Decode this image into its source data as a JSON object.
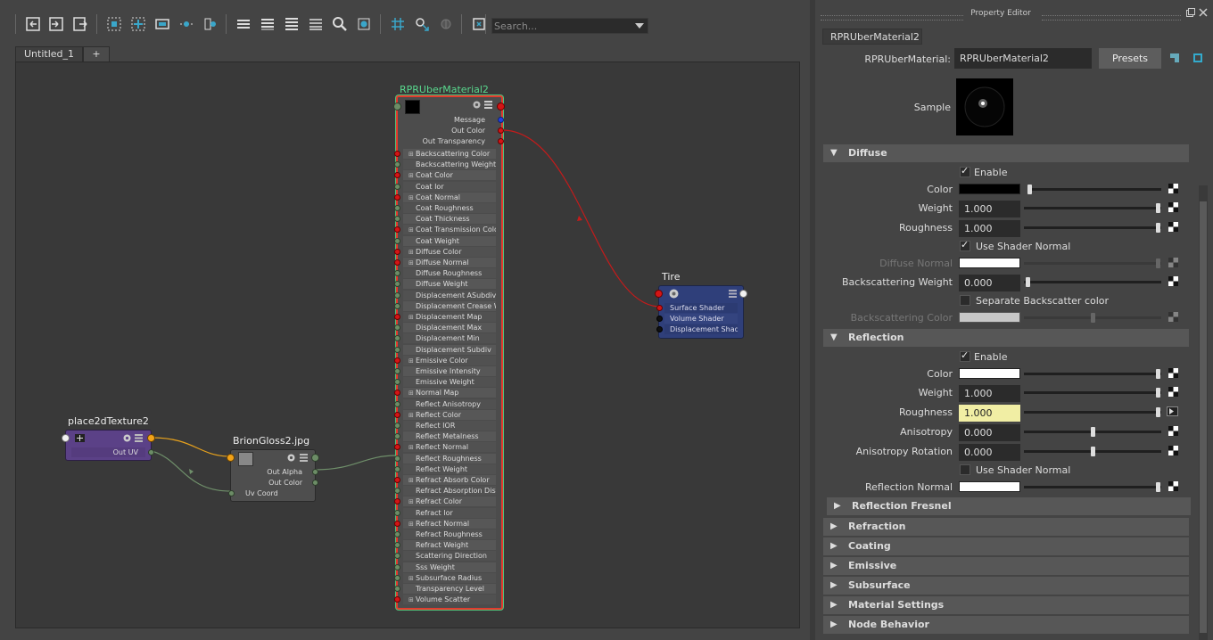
{
  "toolbar": {
    "icons": [
      "input-graph-icon",
      "output-graph-icon",
      "input-output-graph-icon",
      "frame-all-icon",
      "frame-selected-icon",
      "clear-graph-icon",
      "remove-selected-icon",
      "add-selected-icon",
      "simple-mode-icon",
      "connected-mode-icon",
      "full-mode-icon",
      "custom-mode-icon",
      "search-node-icon",
      "show-swatches-icon",
      "grid-toggle-icon",
      "snap-to-grid-icon",
      "pin-icon",
      "graph-materials-icon"
    ],
    "search_placeholder": "Search..."
  },
  "tabs": {
    "active": "Untitled_1",
    "add": "+"
  },
  "nodes": {
    "uber": {
      "title": "RPRUberMaterial2",
      "message": "Message",
      "out_color": "Out Color",
      "out_transparency": "Out Transparency",
      "attributes": [
        {
          "label": "Backscattering Color",
          "port": "red",
          "expand": true
        },
        {
          "label": "Backscattering Weight",
          "port": "green",
          "expand": false
        },
        {
          "label": "Coat Color",
          "port": "red",
          "expand": true
        },
        {
          "label": "Coat Ior",
          "port": "green",
          "expand": false
        },
        {
          "label": "Coat Normal",
          "port": "red",
          "expand": true
        },
        {
          "label": "Coat Roughness",
          "port": "green",
          "expand": false
        },
        {
          "label": "Coat Thickness",
          "port": "green",
          "expand": false
        },
        {
          "label": "Coat Transmission Color",
          "port": "red",
          "expand": true
        },
        {
          "label": "Coat Weight",
          "port": "green",
          "expand": false
        },
        {
          "label": "Diffuse Color",
          "port": "red",
          "expand": true
        },
        {
          "label": "Diffuse Normal",
          "port": "red",
          "expand": true
        },
        {
          "label": "Diffuse Roughness",
          "port": "green",
          "expand": false
        },
        {
          "label": "Diffuse Weight",
          "port": "green",
          "expand": false
        },
        {
          "label": "Displacement ASubdiv Factor",
          "port": "green",
          "expand": false
        },
        {
          "label": "Displacement Crease Weight",
          "port": "green",
          "expand": false
        },
        {
          "label": "Displacement Map",
          "port": "red",
          "expand": true
        },
        {
          "label": "Displacement Max",
          "port": "green",
          "expand": false
        },
        {
          "label": "Displacement Min",
          "port": "green",
          "expand": false
        },
        {
          "label": "Displacement Subdiv",
          "port": "green",
          "expand": false
        },
        {
          "label": "Emissive Color",
          "port": "red",
          "expand": true
        },
        {
          "label": "Emissive Intensity",
          "port": "green",
          "expand": false
        },
        {
          "label": "Emissive Weight",
          "port": "green",
          "expand": false
        },
        {
          "label": "Normal Map",
          "port": "red",
          "expand": true
        },
        {
          "label": "Reflect Anisotropy",
          "port": "green",
          "expand": false
        },
        {
          "label": "Reflect Color",
          "port": "red",
          "expand": true
        },
        {
          "label": "Reflect IOR",
          "port": "green",
          "expand": false
        },
        {
          "label": "Reflect Metalness",
          "port": "green",
          "expand": false
        },
        {
          "label": "Reflect Normal",
          "port": "red",
          "expand": true
        },
        {
          "label": "Reflect Roughness",
          "port": "green",
          "expand": false
        },
        {
          "label": "Reflect Weight",
          "port": "green",
          "expand": false
        },
        {
          "label": "Refract Absorb Color",
          "port": "red",
          "expand": true
        },
        {
          "label": "Refract Absorption Distance",
          "port": "green",
          "expand": false
        },
        {
          "label": "Refract Color",
          "port": "red",
          "expand": true
        },
        {
          "label": "Refract Ior",
          "port": "green",
          "expand": false
        },
        {
          "label": "Refract Normal",
          "port": "red",
          "expand": true
        },
        {
          "label": "Refract Roughness",
          "port": "green",
          "expand": false
        },
        {
          "label": "Refract Weight",
          "port": "green",
          "expand": false
        },
        {
          "label": "Scattering Direction",
          "port": "green",
          "expand": false
        },
        {
          "label": "Sss Weight",
          "port": "green",
          "expand": false
        },
        {
          "label": "Subsurface Radius",
          "port": "green",
          "expand": true
        },
        {
          "label": "Transparency Level",
          "port": "green",
          "expand": false
        },
        {
          "label": "Volume Scatter",
          "port": "red",
          "expand": true
        }
      ]
    },
    "tire": {
      "title": "Tire",
      "rows": [
        "Surface Shader",
        "Volume Shader",
        "Displacement Shader"
      ]
    },
    "place2d": {
      "title": "place2dTexture2",
      "out_uv": "Out UV"
    },
    "brion": {
      "title": "BrionGloss2.jpg",
      "out_alpha": "Out Alpha",
      "out_color": "Out Color",
      "uv_coord": "Uv Coord"
    }
  },
  "property_editor": {
    "title": "Property Editor",
    "tab": "RPRUberMaterial2",
    "type_label": "RPRUberMaterial:",
    "name_value": "RPRUberMaterial2",
    "presets_label": "Presets",
    "sample_label": "Sample",
    "diffuse": {
      "header": "Diffuse",
      "enable_label": "Enable",
      "enable_checked": true,
      "color_label": "Color",
      "color_value": "#000000",
      "color_slider": 0.0,
      "weight_label": "Weight",
      "weight_value": "1.000",
      "weight_slider": 1.0,
      "roughness_label": "Roughness",
      "roughness_value": "1.000",
      "roughness_slider": 1.0,
      "use_shader_normal_label": "Use Shader Normal",
      "use_shader_normal_checked": true,
      "diffuse_normal_label": "Diffuse Normal",
      "diffuse_normal_value": "#ffffff",
      "backscattering_weight_label": "Backscattering Weight",
      "backscattering_weight_value": "0.000",
      "backscattering_weight_slider": 0.0,
      "separate_backscatter_label": "Separate Backscatter color",
      "separate_backscatter_checked": false,
      "backscattering_color_label": "Backscattering Color",
      "backscattering_color_value": "#c8c8c8",
      "backscattering_color_slider": 0.5
    },
    "reflection": {
      "header": "Reflection",
      "enable_label": "Enable",
      "enable_checked": true,
      "color_label": "Color",
      "color_value": "#ffffff",
      "color_slider": 1.0,
      "weight_label": "Weight",
      "weight_value": "1.000",
      "weight_slider": 1.0,
      "roughness_label": "Roughness",
      "roughness_value": "1.000",
      "roughness_slider": 1.0,
      "anisotropy_label": "Anisotropy",
      "anisotropy_value": "0.000",
      "anisotropy_slider": 0.5,
      "anisotropy_rotation_label": "Anisotropy Rotation",
      "anisotropy_rotation_value": "0.000",
      "anisotropy_rotation_slider": 0.5,
      "use_shader_normal_label": "Use Shader Normal",
      "use_shader_normal_checked": false,
      "reflection_normal_label": "Reflection Normal",
      "reflection_normal_value": "#ffffff"
    },
    "collapsed_sections": [
      "Reflection Fresnel",
      "Refraction",
      "Coating",
      "Emissive",
      "Subsurface",
      "Material Settings",
      "Node Behavior"
    ]
  },
  "colors": {
    "uber_border": "#e23b2e",
    "uber_selected_outline": "#4ec27a",
    "tire_node": "#2f3f7a",
    "place2d_node": "#5b4187",
    "file_node": "#4e4e4e",
    "wire_color": "#c41b1b",
    "wire_uv": "#e6a11d",
    "wire_float": "#6f8f6a",
    "connected_field": "#f1eea4"
  }
}
